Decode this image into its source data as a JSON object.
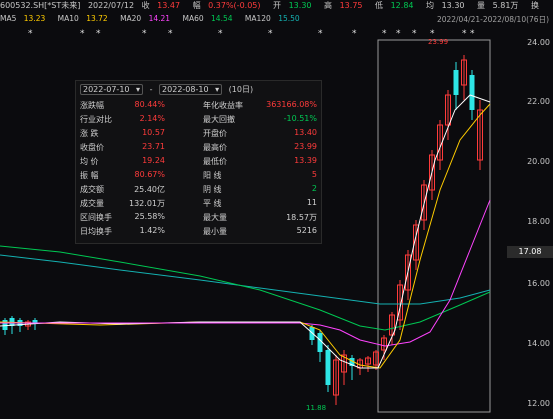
{
  "header": {
    "code": "600532.SH[*ST未来]",
    "date": "2022/07/12",
    "close_label": "收",
    "close_value": "13.47",
    "change_label": "幅",
    "change_value": "0.37%(-0.05)",
    "open_label": "开",
    "open_value": "13.30",
    "high_label": "高",
    "high_value": "13.75",
    "low_label": "低",
    "low_value": "12.84",
    "avg_label": "均",
    "avg_value": "13.30",
    "vol_label": "量",
    "vol_value": "5.81万",
    "turnover_label": "换"
  },
  "ma": {
    "ma5_label": "MA5",
    "ma5_value": "13.23",
    "ma10_label": "MA10",
    "ma10_value": "13.72",
    "ma20_label": "MA20",
    "ma20_value": "14.21",
    "ma60_label": "MA60",
    "ma60_value": "14.54",
    "ma120_label": "MA120",
    "ma120_value": "15.50",
    "date_range": "2022/04/21-2022/08/10(76日)"
  },
  "panel": {
    "start_date": "2022-07-10",
    "end_date": "2022-08-10",
    "days": "(10日)",
    "rows": [
      {
        "l1": "涨跌幅",
        "v1": "80.44%",
        "l2": "年化收益率",
        "v2": "363166.08%"
      },
      {
        "l1": "行业对比",
        "v1": "2.14%",
        "l2": "最大回撤",
        "v2": "-10.51%"
      },
      {
        "l1": "涨    跌",
        "v1": "10.57",
        "l2": "开盘价",
        "v2": "13.40"
      },
      {
        "l1": "收盘价",
        "v1": "23.71",
        "l2": "最高价",
        "v2": "23.99"
      },
      {
        "l1": "均    价",
        "v1": "19.24",
        "l2": "最低价",
        "v2": "13.39"
      },
      {
        "l1": "振    幅",
        "v1": "80.67%",
        "l2": "阳    线",
        "v2": "5"
      },
      {
        "l1": "成交额",
        "v1": "25.40亿",
        "l2": "阴    线",
        "v2": "2"
      },
      {
        "l1": "成交量",
        "v1": "132.01万",
        "l2": "平    线",
        "v2": "11"
      },
      {
        "l1": "区间换手",
        "v1": "25.58%",
        "l2": "最大量",
        "v2": "18.57万"
      },
      {
        "l1": "日均换手",
        "v1": "1.42%",
        "l2": "最小量",
        "v2": "5216"
      }
    ]
  },
  "yaxis": [
    "24.00",
    "22.00",
    "20.00",
    "18.00",
    "16.00",
    "14.00",
    "12.00"
  ],
  "current_price": "17.08",
  "price_high": "23.99",
  "price_low": "11.88",
  "colors": {
    "up": "#ff3b3b",
    "down": "#2ee6e6",
    "ma5": "#ffffff",
    "ma10": "#ffcc00",
    "ma20": "#ff44ff",
    "ma60": "#00c853",
    "ma120": "#14b1b1"
  }
}
